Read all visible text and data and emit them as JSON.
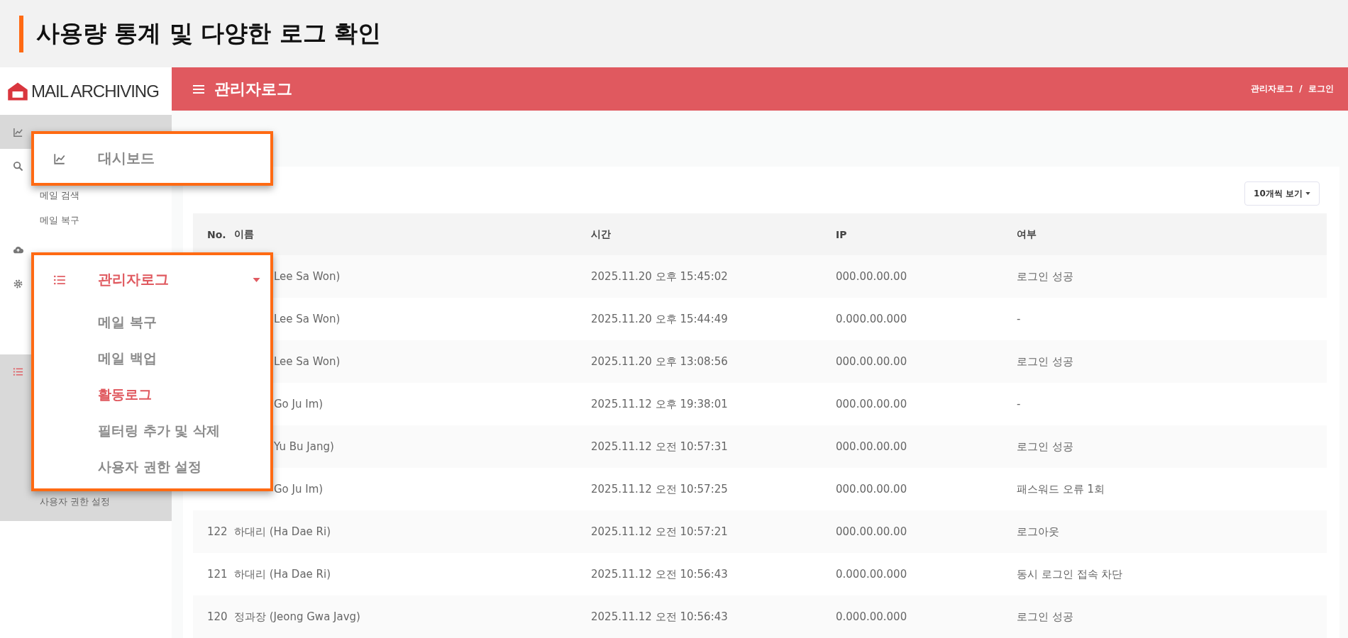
{
  "banner": {
    "title": "사용량 통계 및 다양한 로그 확인"
  },
  "logo": {
    "text": "MAIL ARCHIVING"
  },
  "sidebar": {
    "groups": [
      {
        "expanded": true
      },
      {
        "expanded": false,
        "children": [
          "메일 검색",
          "메일 복구"
        ]
      },
      {
        "expanded": false
      },
      {
        "expanded": false
      },
      {
        "expanded": true,
        "children": [
          "사용자 권한 설정"
        ]
      }
    ]
  },
  "callouts": [
    {
      "label": "대시보드",
      "selected": false
    },
    {
      "label": "관리자로그",
      "selected": true,
      "children": [
        {
          "label": "메일 복구",
          "selected": false
        },
        {
          "label": "메일 백업",
          "selected": false
        },
        {
          "label": "활동로그",
          "selected": true
        },
        {
          "label": "필터링 추가 및 삭제",
          "selected": false
        },
        {
          "label": "사용자 권한 설정",
          "selected": false
        }
      ]
    }
  ],
  "header": {
    "title": "관리자로그",
    "breadcrumb": "관리자로그  /  로그인"
  },
  "page_size": "10개씩 보기",
  "table": {
    "columns": [
      "No.",
      "이름",
      "시간",
      "IP",
      "여부"
    ],
    "rows": [
      {
        "name": "Lee Sa Won)",
        "time": "2025.11.20 오후 15:45:02",
        "ip": "000.00.00.00",
        "result": "로그인 성공"
      },
      {
        "name": "Lee Sa Won)",
        "time": "2025.11.20 오후 15:44:49",
        "ip": "0.000.00.000",
        "result": "-"
      },
      {
        "name": "Lee Sa Won)",
        "time": "2025.11.20 오후 13:08:56",
        "ip": "000.00.00.00",
        "result": "로그인 성공"
      },
      {
        "name": "Go Ju Im)",
        "time": "2025.11.12 오후 19:38:01",
        "ip": "000.00.00.00",
        "result": "-"
      },
      {
        "name": "Yu Bu Jang)",
        "time": "2025.11.12 오전 10:57:31",
        "ip": "000.00.00.00",
        "result": "로그인 성공"
      },
      {
        "name": "Go Ju Im)",
        "time": "2025.11.12 오전 10:57:25",
        "ip": "000.00.00.00",
        "result": "패스워드 오류 1회"
      },
      {
        "no": "122",
        "name": "하대리 (Ha Dae Ri)",
        "time": "2025.11.12 오전 10:57:21",
        "ip": "000.00.00.00",
        "result": "로그아웃"
      },
      {
        "no": "121",
        "name": "하대리 (Ha Dae Ri)",
        "time": "2025.11.12 오전 10:56:43",
        "ip": "0.000.00.000",
        "result": "동시 로그인 접속 차단"
      },
      {
        "no": "120",
        "name": "정과장 (Jeong Gwa Javg)",
        "time": "2025.11.12 오전 10:56:43",
        "ip": "0.000.00.000",
        "result": "로그인 성공"
      }
    ]
  }
}
